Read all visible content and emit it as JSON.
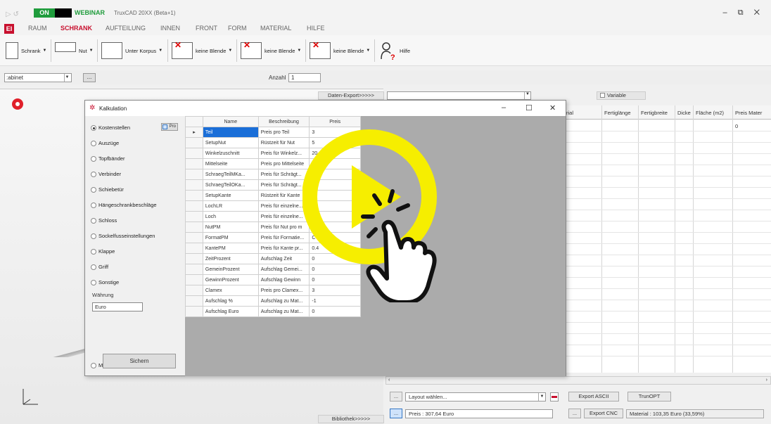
{
  "titlebar": {
    "on_badge": "ON",
    "webinar": "WEBINAR",
    "app_title": "TruxCAD 20XX (Beta+1)",
    "window_controls": "– ⧉ ✕"
  },
  "ribbon_tabs": {
    "file": "EI",
    "items": [
      "RAUM",
      "SCHRANK",
      "AUFTEILUNG",
      "INNEN",
      "FRONT",
      "FORM",
      "MATERIAL",
      "HILFE"
    ],
    "active": "SCHRANK"
  },
  "toolbar": {
    "schrank": "Schrank",
    "nut": "Nut",
    "unter_korpus": "Unter Korpus",
    "blende1": "keine Blende",
    "blende2": "keine Blende",
    "blende3": "keine Blende",
    "hilfe": "Hilfe"
  },
  "cabinet_row": {
    "cabinet_value": ":abinet",
    "ellipsis": "...",
    "anzahl_label": "Anzahl",
    "anzahl_value": "1"
  },
  "export": {
    "daten_export": "Daten-Export>>>>>",
    "variable": "Variable",
    "bibliothek": "Bibliothek>>>>>"
  },
  "right_grid": {
    "headers": [
      "rial",
      "Fertiglänge",
      "Fertigbreite",
      "Dicke",
      "Fläche (m2)",
      "Preis Mater"
    ],
    "first_value": "0"
  },
  "bottom": {
    "ellipsis": "...",
    "layout_placeholder": "Layout wählen...",
    "export_ascii": "Export ASCII",
    "truopt": "TrunOPT",
    "preis": "Preis : 307,64 Euro",
    "export_cnc": "Export CNC",
    "material": "Material : 103,35 Euro (33,59%)"
  },
  "dialog": {
    "title": "Kalkulation",
    "prozent": "Pro",
    "radios": [
      {
        "label": "Kostenstellen",
        "checked": true
      },
      {
        "label": "Auszüge",
        "checked": false
      },
      {
        "label": "Topfbänder",
        "checked": false
      },
      {
        "label": "Verbinder",
        "checked": false
      },
      {
        "label": "Schiebetür",
        "checked": false
      },
      {
        "label": "Hängeschrankbeschläge",
        "checked": false
      },
      {
        "label": "Schloss",
        "checked": false
      },
      {
        "label": "Sockelfusseinstellungen",
        "checked": false
      },
      {
        "label": "Klappe",
        "checked": false
      },
      {
        "label": "Griff",
        "checked": false
      },
      {
        "label": "Sonstige",
        "checked": false
      }
    ],
    "material_radio": "Material",
    "wahrung_label": "Währung",
    "wahrung_value": "Euro",
    "sichern": "Sichern",
    "table": {
      "headers": [
        "Name",
        "Beschreibung",
        "Preis"
      ],
      "rows": [
        [
          "Teil",
          "Preis pro Teil",
          "3"
        ],
        [
          "SetupNut",
          "Rüstzeit für Nut",
          "5"
        ],
        [
          "Winkelzuschnitt",
          "Preis für Winkelz...",
          "20"
        ],
        [
          "Mittelseite",
          "Preis pro Mittelseite",
          "10"
        ],
        [
          "SchraegTeilMKa...",
          "Preis für Schrägt...",
          "2"
        ],
        [
          "SchraegTeilOKa...",
          "Preis für Schrägt...",
          ""
        ],
        [
          "SetupKante",
          "Rüstzeit für Kante",
          ""
        ],
        [
          "LochLR",
          "Preis für einzelne...",
          ""
        ],
        [
          "Loch",
          "Preis für einzelne...",
          "5"
        ],
        [
          "NutPM",
          "Preis für Nut pro m",
          ""
        ],
        [
          "FormatPM",
          "Preis für Formatie...",
          "C"
        ],
        [
          "KantePM",
          "Preis für Kante pr...",
          "0.4"
        ],
        [
          "ZeitProzent",
          "Aufschlag Zeit",
          "0"
        ],
        [
          "GemeinProzent",
          "Aufschlag Gemei...",
          "0"
        ],
        [
          "GewinnProzent",
          "Aufschlag Gewinn",
          "0"
        ],
        [
          "Clamex",
          "Preis pro Clamex...",
          "3"
        ],
        [
          "Aufschlag %",
          "Aufschlag zu Mat...",
          "-1"
        ],
        [
          "Aufschlag Euro",
          "Aufschlag zu Mat...",
          "0"
        ]
      ]
    }
  },
  "colors": {
    "accent_red": "#c8102e",
    "on_green": "#1f9c3c",
    "selection_blue": "#1a6ed8",
    "overlay_yellow": "#f6ee00"
  }
}
